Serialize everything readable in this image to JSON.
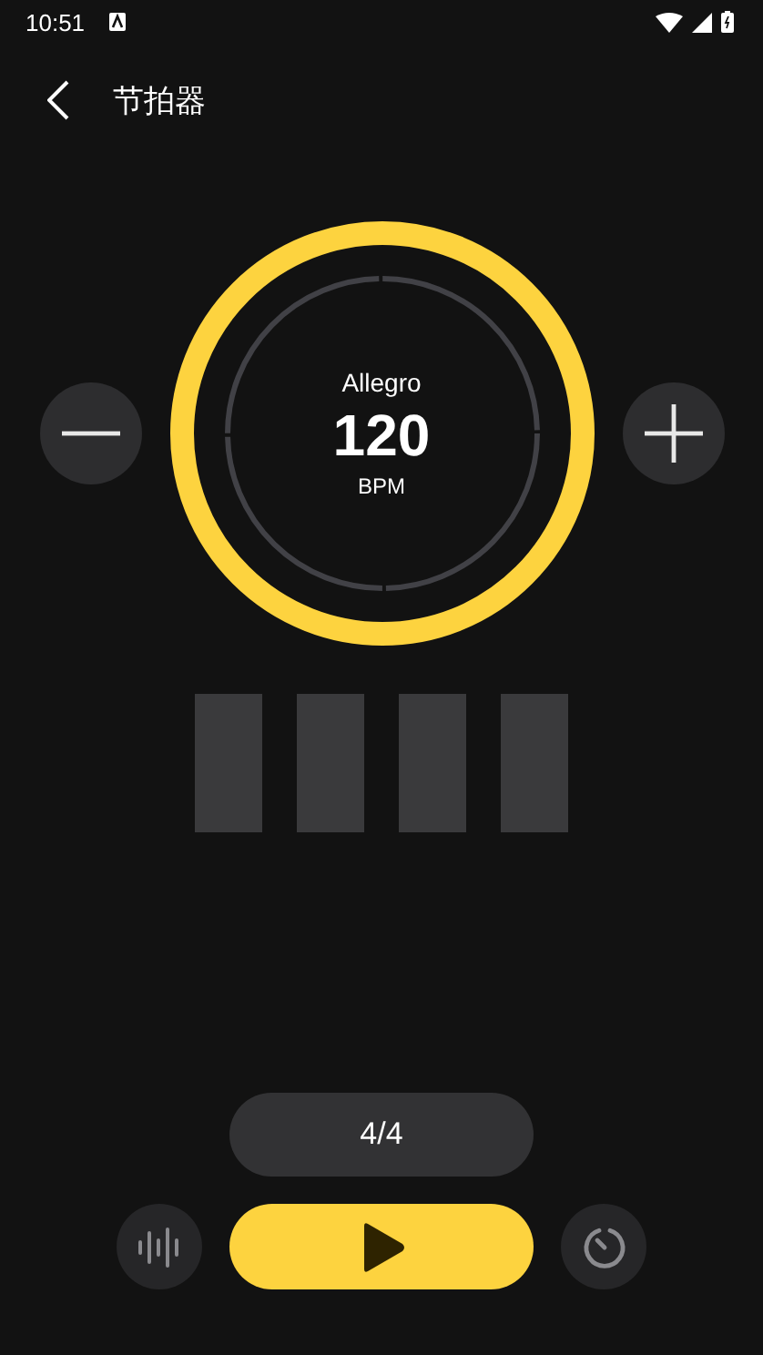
{
  "status_bar": {
    "time": "10:51"
  },
  "header": {
    "title": "节拍器"
  },
  "tempo": {
    "marking": "Allegro",
    "bpm": "120",
    "unit": "BPM"
  },
  "time_signature": "4/4"
}
